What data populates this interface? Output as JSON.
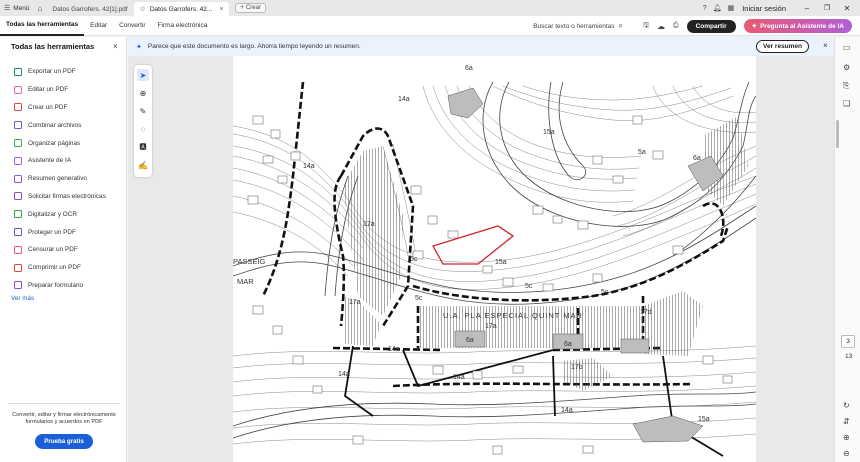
{
  "titlebar": {
    "menu_label": "Menú",
    "tabs": [
      {
        "label": "Datos Garrofers. 42[1].pdf",
        "active": false
      },
      {
        "label": "Datos Garrofers. 42...",
        "active": true
      }
    ],
    "new_tab_label": "Crear",
    "signin_label": "Iniciar sesión"
  },
  "menubar": {
    "items": [
      "Todas las herramientas",
      "Editar",
      "Convertir",
      "Firma electrónica"
    ],
    "search_label": "Buscar texto o herramientas",
    "share_label": "Compartir",
    "ai_label": "Pregunta al Asistente de IA"
  },
  "leftpanel": {
    "title": "Todas las herramientas",
    "tools": [
      {
        "label": "Exportar un PDF",
        "color": "#1a8a64"
      },
      {
        "label": "Editar un PDF",
        "color": "#e06bb0"
      },
      {
        "label": "Crear un PDF",
        "color": "#e04848"
      },
      {
        "label": "Combinar archivos",
        "color": "#7a55d6"
      },
      {
        "label": "Organizar páginas",
        "color": "#3aa650"
      },
      {
        "label": "Asistente de IA",
        "color": "#9b5de5"
      },
      {
        "label": "Resumen generativo",
        "color": "#8f5ad8"
      },
      {
        "label": "Solicitar firmas electrónicas",
        "color": "#8a4fd0"
      },
      {
        "label": "Digitalizar y OCR",
        "color": "#2fa24a"
      },
      {
        "label": "Proteger un PDF",
        "color": "#6b4fd4"
      },
      {
        "label": "Censurar un PDF",
        "color": "#e05a7a"
      },
      {
        "label": "Comprimir un PDF",
        "color": "#e04848"
      },
      {
        "label": "Preparar formulario",
        "color": "#8a4fd0"
      }
    ],
    "more_label": "Ver más",
    "promo_text": "Convertir, editar y firmar electrónicamente formularios y acuerdos en PDF",
    "promo_button": "Prueba gratis"
  },
  "notice": {
    "text": "Parece que este documento es largo. Ahorra tiempo leyendo un resumen.",
    "button": "Ver resumen"
  },
  "document": {
    "map_labels": [
      "14a",
      "14a",
      "15a",
      "15a",
      "5a",
      "5c",
      "5c",
      "5c",
      "6a",
      "6a",
      "6a",
      "6a",
      "17a",
      "17a",
      "17d",
      "17b",
      "PASSEIG",
      "MAR",
      "U.A. PLA ESPECIAL QUINT MAR",
      "17a",
      "14a",
      "14a",
      "14a",
      "14a",
      "5c",
      "15a"
    ]
  },
  "pager": {
    "current": "3",
    "total": "13"
  }
}
